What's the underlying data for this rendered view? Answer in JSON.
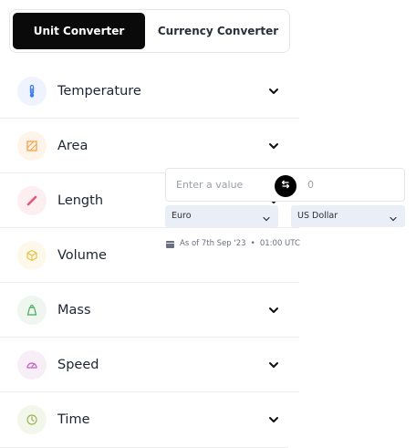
{
  "tabs": [
    {
      "label": "Unit Converter",
      "active": true
    },
    {
      "label": "Currency Converter",
      "active": false
    }
  ],
  "categories": [
    {
      "label": "Temperature",
      "icon": "thermometer-icon",
      "color": "#3b7bf6",
      "bg": "#eef3fe"
    },
    {
      "label": "Area",
      "icon": "area-icon",
      "color": "#f4a04a",
      "bg": "#fef4ea"
    },
    {
      "label": "Length",
      "icon": "ruler-icon",
      "color": "#e8557a",
      "bg": "#fdeef2"
    },
    {
      "label": "Volume",
      "icon": "cube-icon",
      "color": "#e9c14a",
      "bg": "#fdf9ea"
    },
    {
      "label": "Mass",
      "icon": "weight-icon",
      "color": "#4aa85a",
      "bg": "#eef6ef"
    },
    {
      "label": "Speed",
      "icon": "speedometer-icon",
      "color": "#c45fc4",
      "bg": "#f8eef8"
    },
    {
      "label": "Time",
      "icon": "clock-icon",
      "color": "#9bb45a",
      "bg": "#f3f6ea"
    }
  ],
  "converter": {
    "input_placeholder": "Enter a value",
    "output_value": "0",
    "from_currency": "Euro",
    "to_currency": "US Dollar",
    "as_of_date": "As of 7th Sep '23",
    "as_of_time": "01:00 UTC",
    "separator": "•"
  },
  "colors": {
    "active_tab": "#0a0a0a",
    "select_bg": "#e9eef7",
    "divider": "#ececec"
  }
}
